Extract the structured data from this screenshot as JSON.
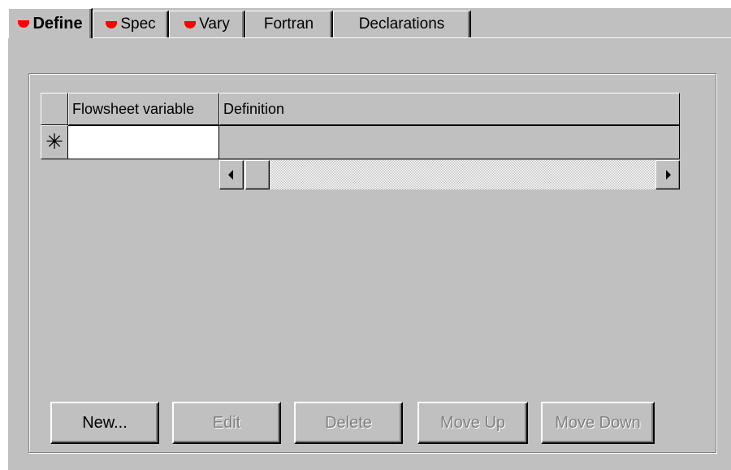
{
  "tabs": [
    {
      "label": "Define",
      "active": true,
      "incomplete_icon": "red-semicircle-icon"
    },
    {
      "label": "Spec",
      "active": false,
      "incomplete_icon": "red-semicircle-icon"
    },
    {
      "label": "Vary",
      "active": false,
      "incomplete_icon": "red-semicircle-icon"
    },
    {
      "label": "Fortran",
      "active": false,
      "incomplete_icon": null
    },
    {
      "label": "Declarations",
      "active": false,
      "incomplete_icon": null
    }
  ],
  "grid": {
    "columns": [
      "Flowsheet variable",
      "Definition"
    ],
    "new_row_marker": "✳",
    "rows": [
      {
        "flowsheet_variable": "",
        "definition": ""
      }
    ]
  },
  "buttons": {
    "new": {
      "label": "New...",
      "enabled": true
    },
    "edit": {
      "label": "Edit",
      "enabled": false
    },
    "delete": {
      "label": "Delete",
      "enabled": false
    },
    "move_up": {
      "label": "Move Up",
      "enabled": false
    },
    "move_down": {
      "label": "Move Down",
      "enabled": false
    }
  },
  "colors": {
    "face": "#c0c0c0",
    "incomplete_indicator": "#ff0000",
    "disabled_text": "#808080"
  }
}
